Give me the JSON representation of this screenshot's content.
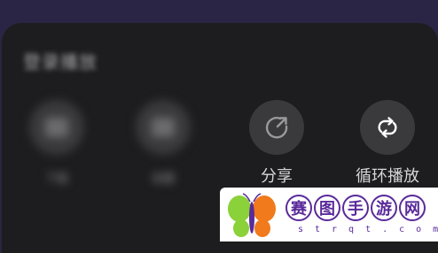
{
  "sheet": {
    "title": "登录播放"
  },
  "actions": [
    {
      "id": "download",
      "label": "下载",
      "icon": "download-icon"
    },
    {
      "id": "collect",
      "label": "收藏",
      "icon": "collect-icon"
    },
    {
      "id": "share",
      "label": "分享",
      "icon": "share-icon"
    },
    {
      "id": "loop",
      "label": "循环播放",
      "icon": "loop-icon"
    }
  ],
  "watermark": {
    "chars": [
      "赛",
      "图",
      "手",
      "游",
      "网"
    ],
    "sub": "strqt.com"
  },
  "colors": {
    "sheet_bg": "#1d1d1f",
    "circle_bg": "#3a3a3d",
    "label_text": "#d6d6d8",
    "watermark_purple": "#5a2a9a",
    "butterfly_green": "#8bd13a",
    "butterfly_orange": "#f07a1c"
  }
}
